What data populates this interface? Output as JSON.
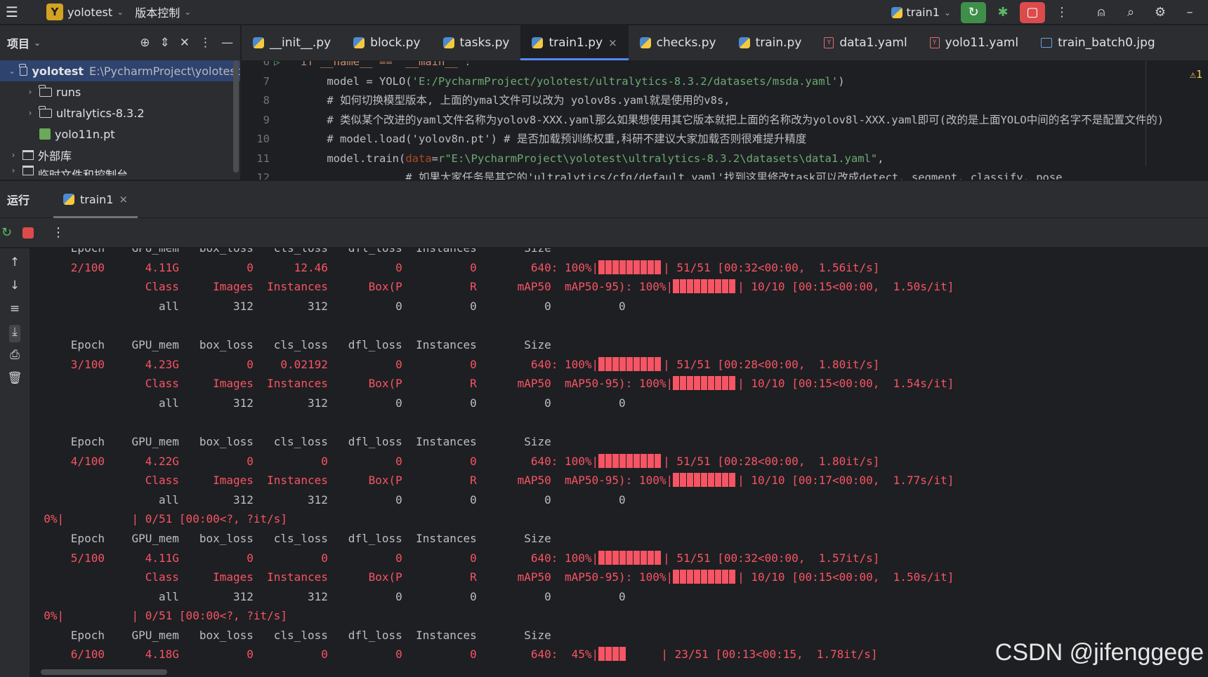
{
  "topbar": {
    "menu_icon": "hamburger-icon",
    "project_badge": "Y",
    "project_name": "yolotest",
    "vcs_label": "版本控制",
    "run_config": "train1"
  },
  "project_panel": {
    "title": "项目",
    "items": [
      {
        "label": "yolotest",
        "path": "E:\\PycharmProject\\yolotest"
      },
      {
        "label": "runs"
      },
      {
        "label": "ultralytics-8.3.2"
      },
      {
        "label": "yolo11n.pt"
      },
      {
        "label": "外部库"
      },
      {
        "label": "临时文件和控制台"
      }
    ]
  },
  "editor": {
    "tabs": [
      {
        "label": "__init__.py"
      },
      {
        "label": "block.py"
      },
      {
        "label": "tasks.py"
      },
      {
        "label": "train1.py"
      },
      {
        "label": "checks.py"
      },
      {
        "label": "train.py"
      },
      {
        "label": "data1.yaml"
      },
      {
        "label": "yolo11.yaml"
      },
      {
        "label": "train_batch0.jpg"
      }
    ],
    "line_numbers": [
      "6",
      "7",
      "8",
      "9",
      "10",
      "11",
      "12"
    ],
    "code": {
      "l6": "if __name__ == '__main__':",
      "l7a": "    model = YOLO(",
      "l7b": "'E:/PycharmProject/yolotest/ultralytics-8.3.2/datasets/msda.yaml'",
      "l7c": ")",
      "l8": "    # 如何切换模型版本, 上面的ymal文件可以改为 yolov8s.yaml就是使用的v8s,",
      "l9": "    # 类似某个改进的yaml文件名称为yolov8-XXX.yaml那么如果想使用其它版本就把上面的名称改为yolov8l-XXX.yaml即可(改的是上面YOLO中间的名字不是配置文件的)",
      "l10": "    # model.load('yolov8n.pt') # 是否加载预训练权重,科研不建议大家加载否则很难提升精度",
      "l11a": "    model.train(",
      "l11b": "data",
      "l11c": "=",
      "l11d": "r\"E:\\PycharmProject\\yolotest\\ultralytics-8.3.2\\datasets\\data1.yaml\"",
      "l11e": ",",
      "l12": "                # 如果大家任务是其它的'ultralytics/cfg/default.yaml'找到这里修改task可以改成detect, segment, classify, pose"
    },
    "warning_count": "1"
  },
  "run_panel": {
    "label": "运行",
    "tab": "train1"
  },
  "console": {
    "header_epoch": "      Epoch    GPU_mem   box_loss   cls_loss   dfl_loss  Instances       Size",
    "header_val": "                 Class     Images  Instances      Box(P          R      mAP50  mAP50-95): 100%|",
    "blocks": [
      {
        "epoch": "      2/100      4.11G          0      12.46          0          0        640: 100%|",
        "train_tail": "| 51/51 [00:32<00:00,  1.56it/s]",
        "val_tail": "| 10/10 [00:15<00:00,  1.50s/it]",
        "all": "                   all        312        312          0          0          0          0"
      },
      {
        "epoch": "      3/100      4.23G          0    0.02192          0          0        640: 100%|",
        "train_tail": "| 51/51 [00:28<00:00,  1.80it/s]",
        "val_tail": "| 10/10 [00:15<00:00,  1.54s/it]",
        "all": "                   all        312        312          0          0          0          0"
      },
      {
        "epoch": "      4/100      4.22G          0          0          0          0        640: 100%|",
        "train_tail": "| 51/51 [00:28<00:00,  1.80it/s]",
        "val_tail": "| 10/10 [00:17<00:00,  1.77s/it]",
        "all": "                   all        312        312          0          0          0          0"
      },
      {
        "epoch": "      5/100      4.11G          0          0          0          0        640: 100%|",
        "train_tail": "| 51/51 [00:32<00:00,  1.57it/s]",
        "val_tail": "| 10/10 [00:15<00:00,  1.50s/it]",
        "all": "                   all        312        312          0          0          0          0"
      }
    ],
    "zero_line": "  0%|          | 0/51 [00:00<?, ?it/s]",
    "last_epoch": "      6/100      4.18G          0          0          0          0        640:  45%|",
    "last_tail": "     | 23/51 [00:13<00:15,  1.78it/s]",
    "last_progress": 0.45
  },
  "watermark": "CSDN @jifenggege",
  "colors": {
    "accent": "#548af7",
    "progress": "#f75464",
    "run_green": "#3f8f4b",
    "stop_red": "#db4b4b"
  }
}
